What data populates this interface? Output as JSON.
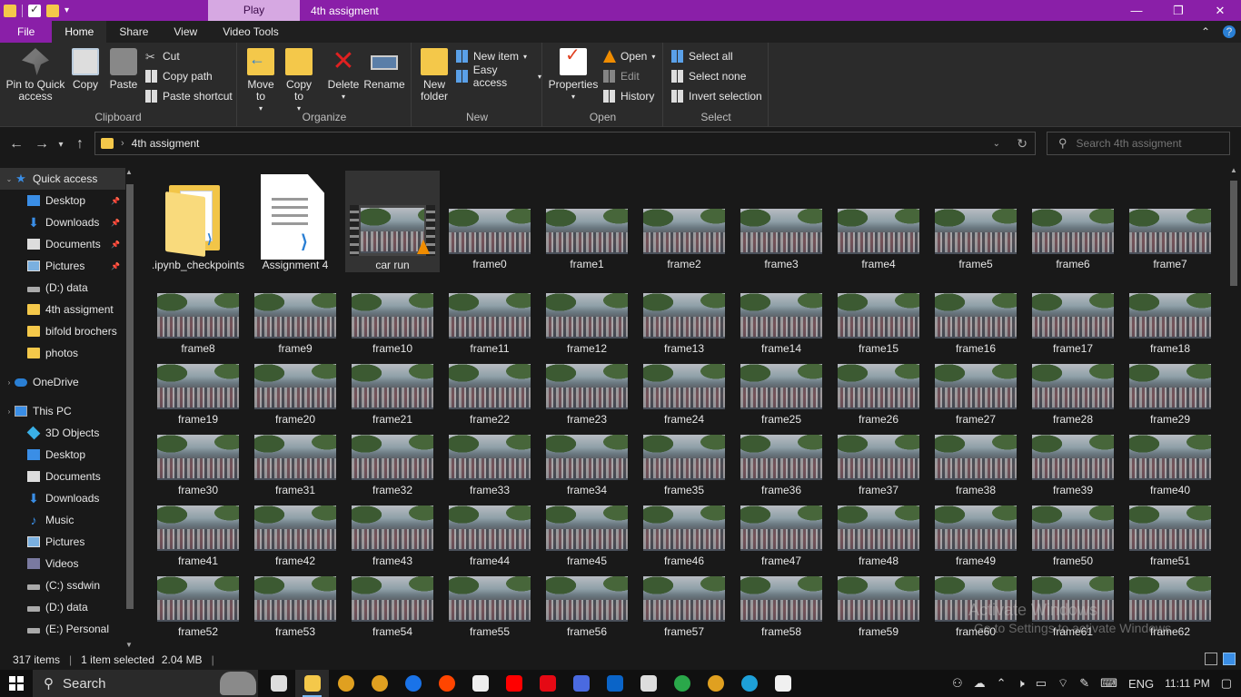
{
  "titlebar": {
    "contextual_tab": "Play",
    "title": "4th assigment",
    "minimize": "—",
    "maximize": "❐",
    "close": "✕"
  },
  "ribbon_tabs": {
    "file": "File",
    "home": "Home",
    "share": "Share",
    "view": "View",
    "video_tools": "Video Tools"
  },
  "ribbon": {
    "clipboard": {
      "label": "Clipboard",
      "pin": "Pin to Quick access",
      "copy": "Copy",
      "paste": "Paste",
      "cut": "Cut",
      "copy_path": "Copy path",
      "paste_shortcut": "Paste shortcut"
    },
    "organize": {
      "label": "Organize",
      "move_to": "Move to",
      "copy_to": "Copy to",
      "delete": "Delete",
      "rename": "Rename"
    },
    "new": {
      "label": "New",
      "new_folder": "New folder",
      "new_item": "New item",
      "easy_access": "Easy access"
    },
    "open": {
      "label": "Open",
      "properties": "Properties",
      "open": "Open",
      "edit": "Edit",
      "history": "History"
    },
    "select": {
      "label": "Select",
      "select_all": "Select all",
      "select_none": "Select none",
      "invert_selection": "Invert selection"
    }
  },
  "address": {
    "path": "4th assigment",
    "search_placeholder": "Search 4th assigment"
  },
  "sidebar": {
    "items": [
      {
        "label": "Quick access",
        "icon": "star-icon"
      },
      {
        "label": "Desktop",
        "icon": "desktop-icon"
      },
      {
        "label": "Downloads",
        "icon": "downloads-icon"
      },
      {
        "label": "Documents",
        "icon": "documents-icon"
      },
      {
        "label": "Pictures",
        "icon": "pictures-icon"
      },
      {
        "label": "(D:) data",
        "icon": "drive-icon"
      },
      {
        "label": "4th assigment",
        "icon": "folder-icon"
      },
      {
        "label": "bifold brochers",
        "icon": "folder-icon"
      },
      {
        "label": "photos",
        "icon": "folder-icon"
      },
      {
        "label": "OneDrive",
        "icon": "cloud-icon"
      },
      {
        "label": "This PC",
        "icon": "pc-icon"
      },
      {
        "label": "3D Objects",
        "icon": "cube-icon"
      },
      {
        "label": "Desktop",
        "icon": "desktop-icon"
      },
      {
        "label": "Documents",
        "icon": "documents-icon"
      },
      {
        "label": "Downloads",
        "icon": "downloads-icon"
      },
      {
        "label": "Music",
        "icon": "music-icon"
      },
      {
        "label": "Pictures",
        "icon": "pictures-icon"
      },
      {
        "label": "Videos",
        "icon": "videos-icon"
      },
      {
        "label": "(C:) ssdwin",
        "icon": "drive-icon"
      },
      {
        "label": "(D:) data",
        "icon": "drive-icon"
      },
      {
        "label": "(E:) Personal",
        "icon": "drive-icon"
      }
    ]
  },
  "files": {
    "special": [
      {
        "name": ".ipynb_checkpoints",
        "type": "folder"
      },
      {
        "name": "Assignment 4",
        "type": "notebook"
      },
      {
        "name": "car run",
        "type": "video"
      }
    ],
    "frames": [
      "frame0",
      "frame1",
      "frame2",
      "frame3",
      "frame4",
      "frame5",
      "frame6",
      "frame7",
      "frame8",
      "frame9",
      "frame10",
      "frame11",
      "frame12",
      "frame13",
      "frame14",
      "frame15",
      "frame16",
      "frame17",
      "frame18",
      "frame19",
      "frame20",
      "frame21",
      "frame22",
      "frame23",
      "frame24",
      "frame25",
      "frame26",
      "frame27",
      "frame28",
      "frame29",
      "frame30",
      "frame31",
      "frame32",
      "frame33",
      "frame34",
      "frame35",
      "frame36",
      "frame37",
      "frame38",
      "frame39",
      "frame40",
      "frame41",
      "frame42",
      "frame43",
      "frame44",
      "frame45",
      "frame46",
      "frame47",
      "frame48",
      "frame49",
      "frame50",
      "frame51",
      "frame52",
      "frame53",
      "frame54",
      "frame55",
      "frame56",
      "frame57",
      "frame58",
      "frame59",
      "frame60",
      "frame61",
      "frame62"
    ]
  },
  "watermark": {
    "line1": "Activate Windows",
    "line2": "Go to Settings to activate Windows."
  },
  "status": {
    "items": "317 items",
    "selected": "1 item selected",
    "size": "2.04 MB"
  },
  "taskbar": {
    "search": "Search",
    "apps": [
      "task-view-icon",
      "file-explorer-icon",
      "chrome-icon",
      "chrome-icon",
      "firefox-icon",
      "reddit-icon",
      "wikipedia-icon",
      "youtube-icon",
      "netflix-icon",
      "prime-icon",
      "outlook-icon",
      "amazon-icon",
      "app-icon",
      "chrome-icon",
      "edge-icon",
      "notepad-icon"
    ],
    "language": "ENG",
    "time": "11:11 PM"
  }
}
